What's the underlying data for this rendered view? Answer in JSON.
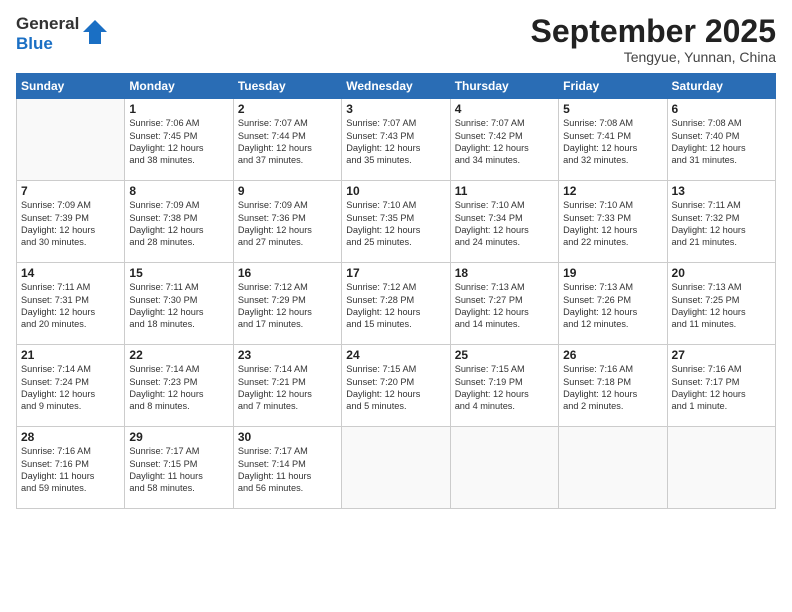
{
  "logo": {
    "line1": "General",
    "line2": "Blue"
  },
  "title": "September 2025",
  "location": "Tengyue, Yunnan, China",
  "weekdays": [
    "Sunday",
    "Monday",
    "Tuesday",
    "Wednesday",
    "Thursday",
    "Friday",
    "Saturday"
  ],
  "weeks": [
    [
      {
        "day": "",
        "info": ""
      },
      {
        "day": "1",
        "info": "Sunrise: 7:06 AM\nSunset: 7:45 PM\nDaylight: 12 hours\nand 38 minutes."
      },
      {
        "day": "2",
        "info": "Sunrise: 7:07 AM\nSunset: 7:44 PM\nDaylight: 12 hours\nand 37 minutes."
      },
      {
        "day": "3",
        "info": "Sunrise: 7:07 AM\nSunset: 7:43 PM\nDaylight: 12 hours\nand 35 minutes."
      },
      {
        "day": "4",
        "info": "Sunrise: 7:07 AM\nSunset: 7:42 PM\nDaylight: 12 hours\nand 34 minutes."
      },
      {
        "day": "5",
        "info": "Sunrise: 7:08 AM\nSunset: 7:41 PM\nDaylight: 12 hours\nand 32 minutes."
      },
      {
        "day": "6",
        "info": "Sunrise: 7:08 AM\nSunset: 7:40 PM\nDaylight: 12 hours\nand 31 minutes."
      }
    ],
    [
      {
        "day": "7",
        "info": "Sunrise: 7:09 AM\nSunset: 7:39 PM\nDaylight: 12 hours\nand 30 minutes."
      },
      {
        "day": "8",
        "info": "Sunrise: 7:09 AM\nSunset: 7:38 PM\nDaylight: 12 hours\nand 28 minutes."
      },
      {
        "day": "9",
        "info": "Sunrise: 7:09 AM\nSunset: 7:36 PM\nDaylight: 12 hours\nand 27 minutes."
      },
      {
        "day": "10",
        "info": "Sunrise: 7:10 AM\nSunset: 7:35 PM\nDaylight: 12 hours\nand 25 minutes."
      },
      {
        "day": "11",
        "info": "Sunrise: 7:10 AM\nSunset: 7:34 PM\nDaylight: 12 hours\nand 24 minutes."
      },
      {
        "day": "12",
        "info": "Sunrise: 7:10 AM\nSunset: 7:33 PM\nDaylight: 12 hours\nand 22 minutes."
      },
      {
        "day": "13",
        "info": "Sunrise: 7:11 AM\nSunset: 7:32 PM\nDaylight: 12 hours\nand 21 minutes."
      }
    ],
    [
      {
        "day": "14",
        "info": "Sunrise: 7:11 AM\nSunset: 7:31 PM\nDaylight: 12 hours\nand 20 minutes."
      },
      {
        "day": "15",
        "info": "Sunrise: 7:11 AM\nSunset: 7:30 PM\nDaylight: 12 hours\nand 18 minutes."
      },
      {
        "day": "16",
        "info": "Sunrise: 7:12 AM\nSunset: 7:29 PM\nDaylight: 12 hours\nand 17 minutes."
      },
      {
        "day": "17",
        "info": "Sunrise: 7:12 AM\nSunset: 7:28 PM\nDaylight: 12 hours\nand 15 minutes."
      },
      {
        "day": "18",
        "info": "Sunrise: 7:13 AM\nSunset: 7:27 PM\nDaylight: 12 hours\nand 14 minutes."
      },
      {
        "day": "19",
        "info": "Sunrise: 7:13 AM\nSunset: 7:26 PM\nDaylight: 12 hours\nand 12 minutes."
      },
      {
        "day": "20",
        "info": "Sunrise: 7:13 AM\nSunset: 7:25 PM\nDaylight: 12 hours\nand 11 minutes."
      }
    ],
    [
      {
        "day": "21",
        "info": "Sunrise: 7:14 AM\nSunset: 7:24 PM\nDaylight: 12 hours\nand 9 minutes."
      },
      {
        "day": "22",
        "info": "Sunrise: 7:14 AM\nSunset: 7:23 PM\nDaylight: 12 hours\nand 8 minutes."
      },
      {
        "day": "23",
        "info": "Sunrise: 7:14 AM\nSunset: 7:21 PM\nDaylight: 12 hours\nand 7 minutes."
      },
      {
        "day": "24",
        "info": "Sunrise: 7:15 AM\nSunset: 7:20 PM\nDaylight: 12 hours\nand 5 minutes."
      },
      {
        "day": "25",
        "info": "Sunrise: 7:15 AM\nSunset: 7:19 PM\nDaylight: 12 hours\nand 4 minutes."
      },
      {
        "day": "26",
        "info": "Sunrise: 7:16 AM\nSunset: 7:18 PM\nDaylight: 12 hours\nand 2 minutes."
      },
      {
        "day": "27",
        "info": "Sunrise: 7:16 AM\nSunset: 7:17 PM\nDaylight: 12 hours\nand 1 minute."
      }
    ],
    [
      {
        "day": "28",
        "info": "Sunrise: 7:16 AM\nSunset: 7:16 PM\nDaylight: 11 hours\nand 59 minutes."
      },
      {
        "day": "29",
        "info": "Sunrise: 7:17 AM\nSunset: 7:15 PM\nDaylight: 11 hours\nand 58 minutes."
      },
      {
        "day": "30",
        "info": "Sunrise: 7:17 AM\nSunset: 7:14 PM\nDaylight: 11 hours\nand 56 minutes."
      },
      {
        "day": "",
        "info": ""
      },
      {
        "day": "",
        "info": ""
      },
      {
        "day": "",
        "info": ""
      },
      {
        "day": "",
        "info": ""
      }
    ]
  ]
}
